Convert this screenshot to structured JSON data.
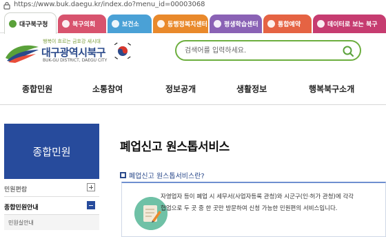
{
  "browser": {
    "url": "https://www.buk.daegu.kr/index.do?menu_id=00003068"
  },
  "site_tabs": [
    {
      "label": "대구북구청",
      "color": "#ffffff",
      "active": true
    },
    {
      "label": "북구의회",
      "color": "#d8536e",
      "active": false
    },
    {
      "label": "보건소",
      "color": "#4aa1d6",
      "active": false
    },
    {
      "label": "동행정복지센터",
      "color": "#e9892b",
      "active": false
    },
    {
      "label": "평생학습센터",
      "color": "#8a62b5",
      "active": false
    },
    {
      "label": "통합예약",
      "color": "#e56343",
      "active": false
    },
    {
      "label": "데이터로 보는 북구",
      "color": "#c63c70",
      "active": false
    }
  ],
  "header": {
    "slogan": "행복이 흐르는 금호강 새시대",
    "logo_name": "대구광역시북구",
    "logo_sub": "BUK-GU DISTRICT, DAEGU CITY",
    "search_placeholder": "검색어를 입력하세요."
  },
  "nav": {
    "items": [
      "종합민원",
      "소통참여",
      "정보공개",
      "생활정보",
      "행복북구소개"
    ]
  },
  "sidebar": {
    "title": "종합민원",
    "items": [
      {
        "label": "민원편람",
        "expanded": false
      },
      {
        "label": "종합민원안내",
        "expanded": true
      }
    ],
    "sub_item": "민원실안내"
  },
  "main": {
    "page_title": "폐업신고 원스톱서비스",
    "section_title": "폐업신고 원스톱서비스란?",
    "info_line1": "자영업자 등이 폐업 시 세무서(사업자등록 관청)와 시군구(인·허가 관청)에 각각",
    "info_line2": "협업으로 두 곳 중 한 곳만 방문하여 신청 가능한 민원편의 서비스입니다."
  },
  "colors": {
    "primary_blue": "#274b9c",
    "green_accent": "#6cae3e"
  }
}
